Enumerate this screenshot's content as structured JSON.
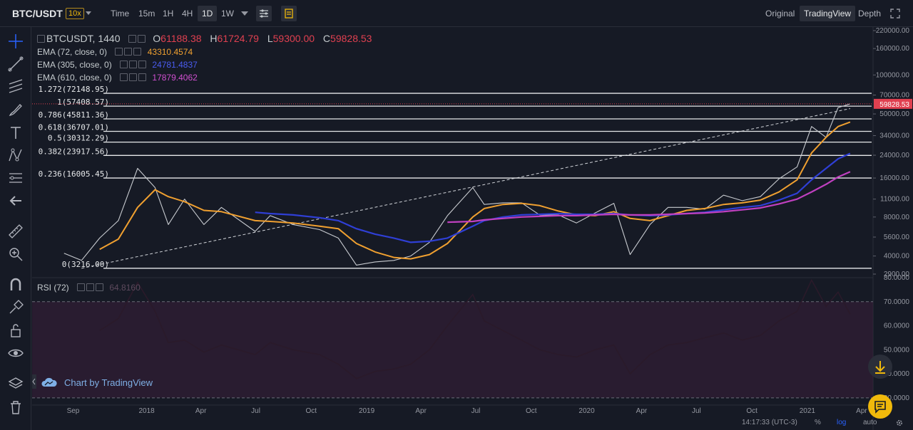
{
  "header": {
    "symbol": "BTC/USDT",
    "leverage": "10x",
    "intervals": [
      "Time",
      "15m",
      "1H",
      "4H",
      "1D",
      "1W"
    ],
    "active_interval": "1D",
    "views": [
      "Original",
      "TradingView",
      "Depth"
    ],
    "active_view": "TradingView"
  },
  "legend": {
    "ohlc_title": "BTCUSDT, 1440",
    "o_label": "O",
    "o_value": "61188.38",
    "h_label": "H",
    "h_value": "61724.79",
    "l_label": "L",
    "l_value": "59300.00",
    "c_label": "C",
    "c_value": "59828.53",
    "ema1_label": "EMA (72, close, 0)",
    "ema1_value": "43310.4574",
    "ema2_label": "EMA (305, close, 0)",
    "ema2_value": "24781.4837",
    "ema3_label": "EMA (610, close, 0)",
    "ema3_value": "17879.4062",
    "rsi_label": "RSI (72)",
    "rsi_value": "64.8160"
  },
  "colors": {
    "ema1": "#f0a030",
    "ema2": "#2f3fd6",
    "ema3": "#c040c0",
    "down": "#e04050",
    "up": "#26a69a",
    "rsi_band": "#3a1f3a"
  },
  "chart_data": [
    {
      "type": "line",
      "scale": "log",
      "x": [
        "2017-08-17",
        "2017-09-15",
        "2017-10-15",
        "2017-11-15",
        "2017-12-17",
        "2018-01-15",
        "2018-02-06",
        "2018-03-05",
        "2018-04-06",
        "2018-05-05",
        "2018-06-30",
        "2018-07-25",
        "2018-09-01",
        "2018-10-15",
        "2018-11-15",
        "2018-12-15",
        "2019-01-15",
        "2019-02-15",
        "2019-03-15",
        "2019-04-15",
        "2019-05-15",
        "2019-06-26",
        "2019-07-15",
        "2019-08-15",
        "2019-09-15",
        "2019-10-15",
        "2019-11-15",
        "2019-12-15",
        "2020-01-15",
        "2020-02-15",
        "2020-03-13",
        "2020-04-15",
        "2020-05-15",
        "2020-06-15",
        "2020-07-15",
        "2020-08-15",
        "2020-09-15",
        "2020-10-15",
        "2020-11-15",
        "2020-12-15",
        "2021-01-08",
        "2021-02-01",
        "2021-02-21",
        "2021-03-13"
      ],
      "series": [
        {
          "values": [
            4200,
            3700,
            5500,
            7500,
            19000,
            13500,
            7000,
            11000,
            7000,
            9500,
            6200,
            8200,
            7000,
            6400,
            5500,
            3400,
            3600,
            3700,
            4000,
            5100,
            8200,
            13500,
            10000,
            10300,
            10300,
            8300,
            8300,
            7200,
            8600,
            10200,
            4100,
            7000,
            9500,
            9500,
            9200,
            11800,
            10700,
            11500,
            15800,
            19500,
            40000,
            33000,
            56000,
            59828
          ]
        },
        {
          "name": "EMA (72, close, 0)",
          "values": [
            null,
            null,
            4500,
            5400,
            9500,
            13000,
            11500,
            10500,
            9000,
            8800,
            7500,
            7400,
            7200,
            6800,
            6500,
            5000,
            4300,
            3900,
            3800,
            4100,
            5000,
            8000,
            9300,
            10000,
            10200,
            9800,
            8900,
            8300,
            8200,
            8800,
            7800,
            7500,
            8200,
            9000,
            9300,
            10000,
            10300,
            10800,
            12500,
            15500,
            25000,
            33000,
            40000,
            43310
          ]
        },
        {
          "name": "EMA (305, close, 0)",
          "values": [
            null,
            null,
            null,
            null,
            null,
            null,
            null,
            null,
            null,
            null,
            8700,
            8500,
            8300,
            7900,
            7500,
            6500,
            5900,
            5500,
            5100,
            5200,
            5500,
            6800,
            7500,
            8000,
            8300,
            8400,
            8500,
            8400,
            8400,
            8500,
            8300,
            8200,
            8300,
            8500,
            8700,
            9100,
            9500,
            9800,
            10800,
            12200,
            15500,
            19000,
            22500,
            24781
          ]
        },
        {
          "name": "EMA (610, close, 0)",
          "values": [
            null,
            null,
            null,
            null,
            null,
            null,
            null,
            null,
            null,
            null,
            null,
            null,
            null,
            null,
            null,
            null,
            null,
            null,
            null,
            null,
            7300,
            7400,
            7600,
            7800,
            8000,
            8100,
            8200,
            8200,
            8300,
            8400,
            8300,
            8300,
            8400,
            8500,
            8600,
            8800,
            9100,
            9400,
            10100,
            11000,
            12500,
            14300,
            16300,
            17879
          ]
        }
      ],
      "title": "BTCUSDT, 1440",
      "y_ticks": [
        "220000.00",
        "160000.00",
        "100000.00",
        "70000.00",
        "50000.00",
        "34000.00",
        "24000.00",
        "16000.00",
        "11000.00",
        "8000.00",
        "5600.00",
        "4000.00",
        "2900.00"
      ],
      "x_ticks": [
        "Sep",
        "2018",
        "Apr",
        "Jul",
        "Oct",
        "2019",
        "Apr",
        "Jul",
        "Oct",
        "2020",
        "Apr",
        "Jul",
        "Oct",
        "2021",
        "Apr"
      ],
      "last_price_label": "59828.53",
      "fib_levels": [
        {
          "label": "1.272(72148.95)",
          "value": 72148.95
        },
        {
          "label": "1(57408.57)",
          "value": 57408.57
        },
        {
          "label": "0.786(45811.36)",
          "value": 45811.36
        },
        {
          "label": "0.618(36707.01)",
          "value": 36707.01
        },
        {
          "label": "0.5(30312.29)",
          "value": 30312.29
        },
        {
          "label": "0.382(23917.56)",
          "value": 23917.56
        },
        {
          "label": "0.236(16005.45)",
          "value": 16005.45
        },
        {
          "label": "0(3216.00)",
          "value": 3216.0
        }
      ],
      "trend_line": {
        "from": {
          "x": "2017-09-15",
          "y": 3216
        },
        "to": {
          "x": "2021-03-13",
          "y": 55000
        }
      }
    },
    {
      "type": "line",
      "x": [
        "2017-08-17",
        "2017-09-15",
        "2017-10-15",
        "2017-11-15",
        "2017-12-17",
        "2018-01-15",
        "2018-02-06",
        "2018-03-05",
        "2018-04-06",
        "2018-05-05",
        "2018-06-30",
        "2018-07-25",
        "2018-09-01",
        "2018-10-15",
        "2018-11-15",
        "2018-12-15",
        "2019-01-15",
        "2019-02-15",
        "2019-03-15",
        "2019-04-15",
        "2019-05-15",
        "2019-06-26",
        "2019-07-15",
        "2019-08-15",
        "2019-09-15",
        "2019-10-15",
        "2019-11-15",
        "2019-12-15",
        "2020-01-15",
        "2020-02-15",
        "2020-03-13",
        "2020-04-15",
        "2020-05-15",
        "2020-06-15",
        "2020-07-15",
        "2020-08-15",
        "2020-09-15",
        "2020-10-15",
        "2020-11-15",
        "2020-12-15",
        "2021-01-08",
        "2021-02-01",
        "2021-02-21",
        "2021-03-13"
      ],
      "series": [
        {
          "name": "RSI (72)",
          "values": [
            null,
            null,
            58,
            63,
            78,
            66,
            53,
            54,
            49,
            52,
            48,
            53,
            50,
            48,
            44,
            38,
            41,
            42,
            44,
            50,
            60,
            73,
            62,
            58,
            54,
            50,
            48,
            47,
            50,
            52,
            40,
            48,
            52,
            53,
            55,
            57,
            54,
            56,
            62,
            66,
            79,
            68,
            74,
            64.816
          ]
        }
      ],
      "y_ticks": [
        "80.0000",
        "70.0000",
        "60.0000",
        "50.0000",
        "40.0000",
        "30.0000"
      ],
      "ylim": [
        27,
        80
      ],
      "bands": [
        30,
        70
      ]
    }
  ],
  "brand": {
    "text": "Chart by TradingView"
  },
  "footer": {
    "time": "14:17:33 (UTC-3)",
    "percent": "%",
    "log": "log",
    "auto": "auto"
  }
}
